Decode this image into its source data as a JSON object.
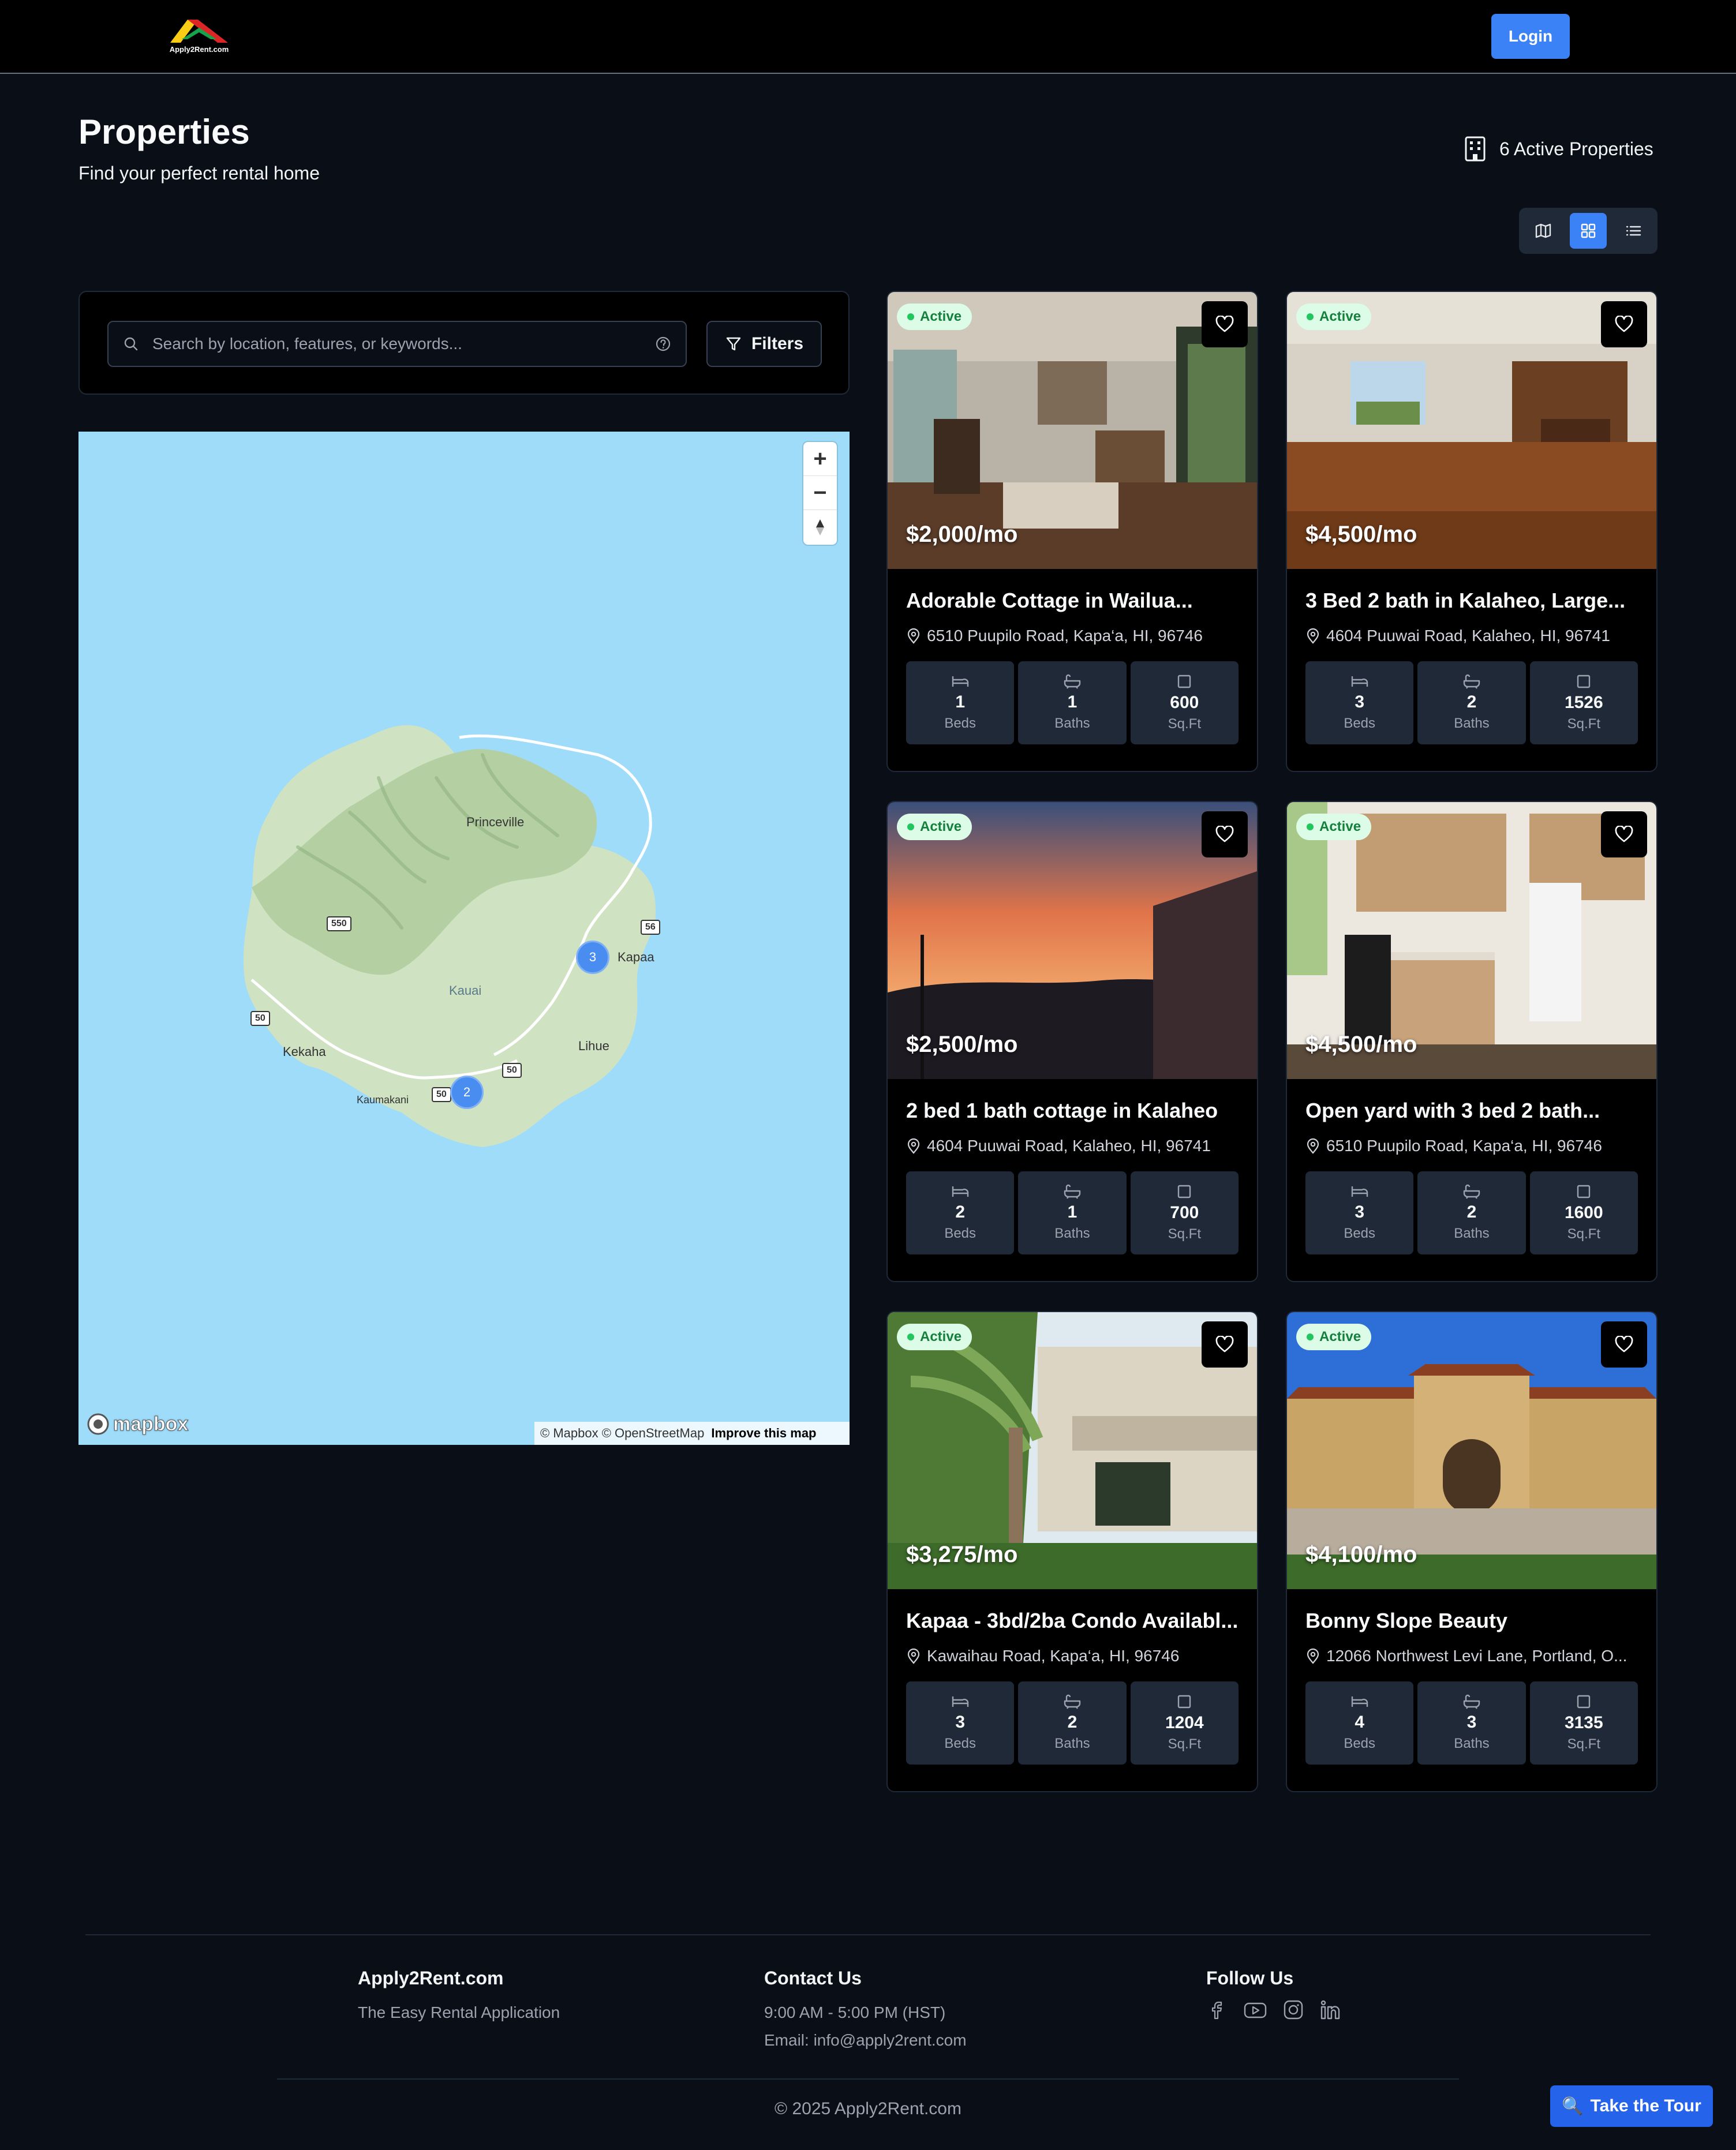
{
  "header": {
    "logo_text": "Apply2Rent.com",
    "login_label": "Login"
  },
  "page": {
    "title": "Properties",
    "subtitle": "Find your perfect rental home",
    "active_count": "6 Active Properties"
  },
  "view_modes": {
    "options": [
      "map",
      "grid",
      "list"
    ],
    "selected": "grid"
  },
  "search": {
    "placeholder": "Search by location, features, or keywords...",
    "filters_label": "Filters"
  },
  "map": {
    "labels": {
      "princeville": "Princeville",
      "kapaa": "Kapaa",
      "kauai": "Kauai",
      "lihue": "Lihue",
      "kekaha": "Kekaha",
      "kaumakani": "Kaumakani"
    },
    "routes": {
      "r550": "550",
      "r56": "56",
      "r50a": "50",
      "r50b": "50",
      "r50c": "50"
    },
    "clusters": {
      "kapaa": "3",
      "south": "2"
    },
    "zoom_in": "+",
    "zoom_out": "−",
    "brand": "mapbox",
    "attribution": "© Mapbox © OpenStreetMap",
    "improve": "Improve this map"
  },
  "listings": [
    {
      "status": "Active",
      "price": "$2,000/mo",
      "title": "Adorable Cottage in Wailua...",
      "address": "6510 Puupilo Road, Kapa‘a, HI, 96746",
      "beds": "1",
      "baths": "1",
      "sqft": "600"
    },
    {
      "status": "Active",
      "price": "$4,500/mo",
      "title": "3 Bed 2 bath in Kalaheo, Large...",
      "address": "4604 Puuwai Road, Kalaheo, HI, 96741",
      "beds": "3",
      "baths": "2",
      "sqft": "1526"
    },
    {
      "status": "Active",
      "price": "$2,500/mo",
      "title": "2 bed 1 bath cottage in Kalaheo",
      "address": "4604 Puuwai Road, Kalaheo, HI, 96741",
      "beds": "2",
      "baths": "1",
      "sqft": "700"
    },
    {
      "status": "Active",
      "price": "$4,500/mo",
      "title": "Open yard with 3 bed 2 bath...",
      "address": "6510 Puupilo Road, Kapa‘a, HI, 96746",
      "beds": "3",
      "baths": "2",
      "sqft": "1600"
    },
    {
      "status": "Active",
      "price": "$3,275/mo",
      "title": "Kapaa - 3bd/2ba Condo Availabl...",
      "address": "Kawaihau Road, Kapa‘a, HI, 96746",
      "beds": "3",
      "baths": "2",
      "sqft": "1204"
    },
    {
      "status": "Active",
      "price": "$4,100/mo",
      "title": "Bonny Slope Beauty",
      "address": "12066 Northwest Levi Lane, Portland, O...",
      "beds": "4",
      "baths": "3",
      "sqft": "3135"
    }
  ],
  "stat_labels": {
    "beds": "Beds",
    "baths": "Baths",
    "sqft": "Sq.Ft"
  },
  "footer": {
    "brand_title": "Apply2Rent.com",
    "brand_tagline": "The Easy Rental Application",
    "contact_title": "Contact Us",
    "contact_hours": "9:00 AM - 5:00 PM (HST)",
    "contact_email": "Email: info@apply2rent.com",
    "follow_title": "Follow Us",
    "social": [
      "facebook-icon",
      "youtube-icon",
      "instagram-icon",
      "linkedin-icon"
    ],
    "copyright": "© 2025 Apply2Rent.com"
  },
  "tour": {
    "label": "Take the Tour",
    "icon": "🔍"
  },
  "colors": {
    "accent": "#3b82f6",
    "background": "#0a0e17",
    "active_badge": "#dcfce7",
    "map_water": "#9edcfa"
  }
}
